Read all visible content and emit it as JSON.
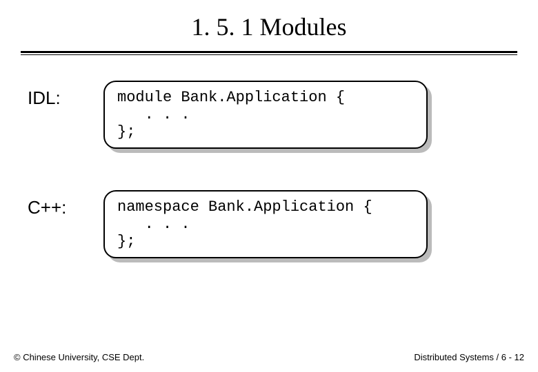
{
  "title": "1. 5. 1 Modules",
  "rows": [
    {
      "label": "IDL:",
      "code": "module Bank.Application {\n   . . .\n};"
    },
    {
      "label": "C++:",
      "code": "namespace Bank.Application {\n   . . .\n};"
    }
  ],
  "footer": {
    "left": "© Chinese University, CSE Dept.",
    "right": "Distributed Systems / 6 - 12"
  }
}
